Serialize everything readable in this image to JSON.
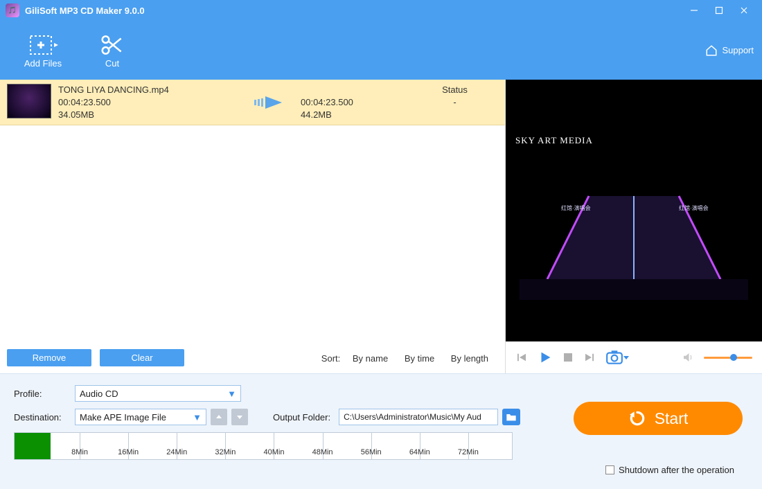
{
  "titlebar": {
    "title": "GiliSoft MP3 CD Maker 9.0.0"
  },
  "toolbar": {
    "add_files": "Add Files",
    "cut": "Cut",
    "support": "Support"
  },
  "file": {
    "name": "TONG LIYA DANCING.mp4",
    "src_duration": "00:04:23.500",
    "src_size": "34.05MB",
    "dst_duration": "00:04:23.500",
    "dst_size": "44.2MB",
    "status_header": "Status",
    "status_value": "-"
  },
  "list_actions": {
    "remove": "Remove",
    "clear": "Clear"
  },
  "sort": {
    "label": "Sort:",
    "by_name": "By name",
    "by_time": "By time",
    "by_length": "By length"
  },
  "preview": {
    "watermark": "SKY ART MEDIA"
  },
  "bottom": {
    "profile_label": "Profile:",
    "profile_value": "Audio CD",
    "dest_label": "Destination:",
    "dest_value": "Make APE Image File",
    "output_folder_label": "Output Folder:",
    "output_folder_value": "C:\\Users\\Administrator\\Music\\My Aud",
    "start": "Start",
    "shutdown": "Shutdown after the operation",
    "ticks": [
      "8Min",
      "16Min",
      "24Min",
      "32Min",
      "40Min",
      "48Min",
      "56Min",
      "64Min",
      "72Min"
    ]
  }
}
